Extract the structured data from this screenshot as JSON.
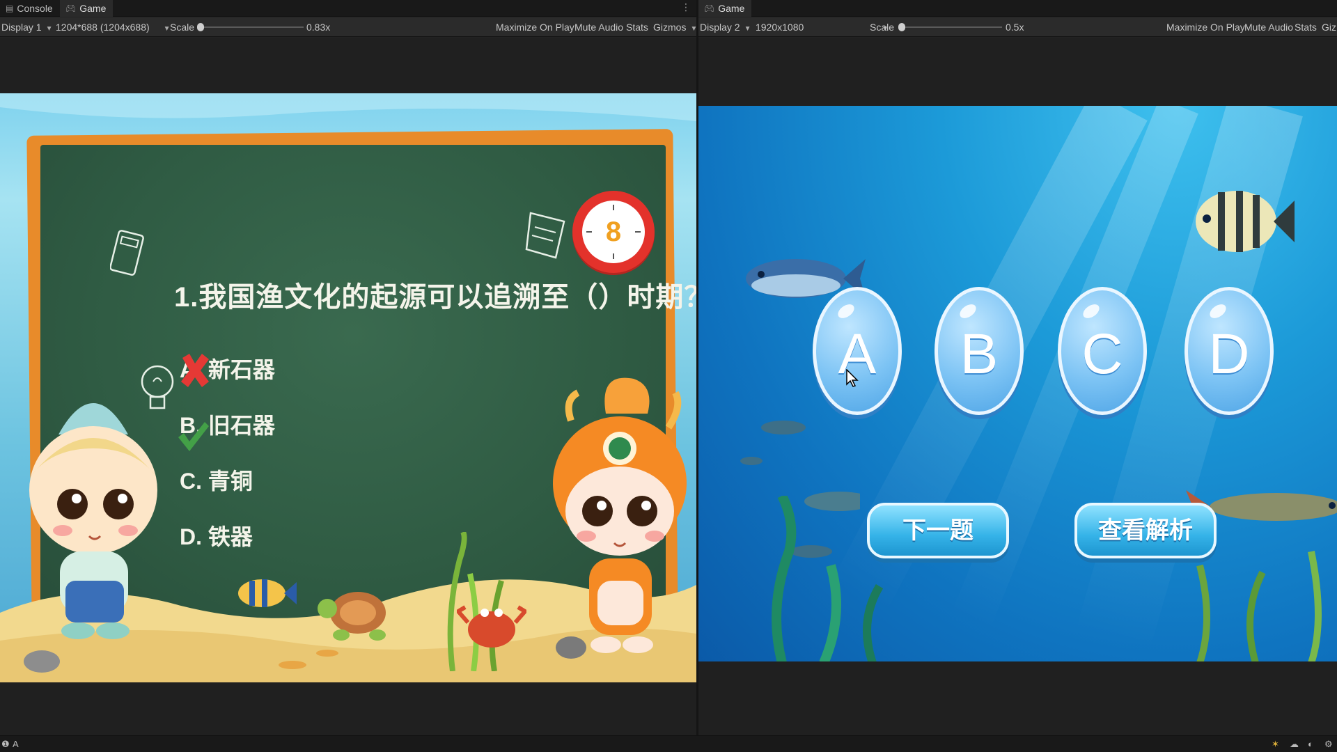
{
  "left_window": {
    "tabs": [
      {
        "label": "Console",
        "icon": "console-icon"
      },
      {
        "label": "Game",
        "icon": "gamepad-icon"
      }
    ],
    "toolbar": {
      "display": "Display 1",
      "resolution": "1204*688 (1204x688)",
      "scale_label": "Scale",
      "scale_value": "0.83x",
      "scale_level": 0.0,
      "maximize": "Maximize On Play",
      "mute": "Mute Audio",
      "stats": "Stats",
      "gizmos": "Gizmos"
    },
    "game": {
      "question": "1.我国渔文化的起源可以追溯至（）时期？",
      "timer": "8",
      "options": [
        {
          "label": "A. 新石器",
          "state": "wrong"
        },
        {
          "label": "B. 旧石器",
          "state": "correct"
        },
        {
          "label": "C. 青铜",
          "state": "none"
        },
        {
          "label": "D. 铁器",
          "state": "none"
        }
      ]
    }
  },
  "right_window": {
    "tabs": [
      {
        "label": "Game",
        "icon": "gamepad-icon"
      }
    ],
    "toolbar": {
      "display": "Display 2",
      "resolution": "1920x1080",
      "scale_label": "Scale",
      "scale_value": "0.5x",
      "scale_level": 0.0,
      "maximize": "Maximize On Play",
      "mute": "Mute Audio",
      "stats": "Stats",
      "gizmos": "Giz"
    },
    "game": {
      "answer_buttons": [
        "A",
        "B",
        "C",
        "D"
      ],
      "next_button": "下一题",
      "analysis_button": "查看解析"
    }
  },
  "status_bar": {
    "text": "A"
  },
  "colors": {
    "chalkboard": "#2f5b43",
    "board_frame": "#e88b2a",
    "timer_ring": "#e3322b",
    "wrong": "#e53935",
    "correct": "#43a047",
    "bubble": "#7cc3f4",
    "action_button": "#35b3e8"
  }
}
